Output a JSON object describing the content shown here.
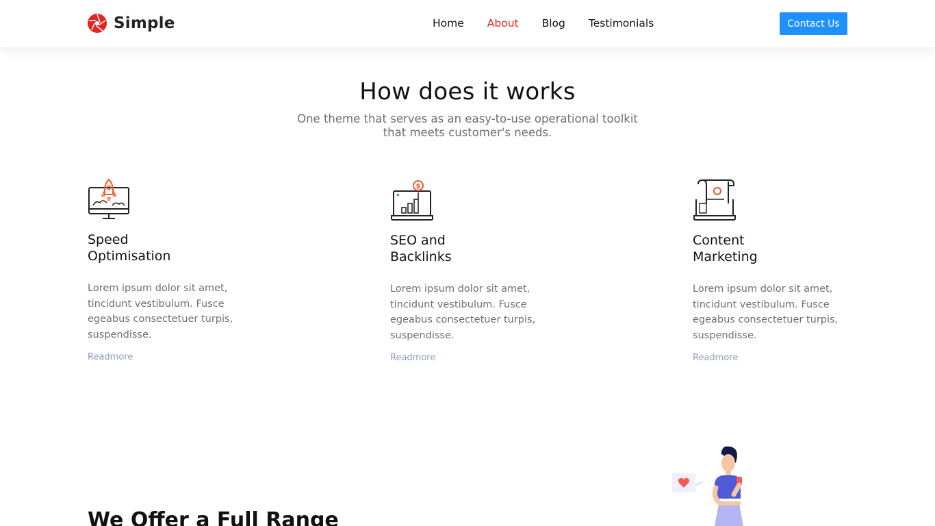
{
  "brand": {
    "name": "Simple",
    "accent": "#e52320"
  },
  "nav": {
    "items": [
      {
        "label": "Home",
        "active": false
      },
      {
        "label": "About",
        "active": true
      },
      {
        "label": "Blog",
        "active": false
      },
      {
        "label": "Testimonials",
        "active": false
      }
    ],
    "cta_label": "Contact Us",
    "cta_color": "#1e90ff"
  },
  "how": {
    "title": "How does it works",
    "subtitle_line1": "One theme that serves as an easy-to-use operational toolkit",
    "subtitle_line2": "that meets customer's needs."
  },
  "features": [
    {
      "icon": "rocket-monitor-icon",
      "title_line1": "Speed",
      "title_line2": "Optimisation",
      "text": "Lorem ipsum dolor sit amet, tincidunt vestibulum. Fusce egeabus consectetuer turpis, suspendisse.",
      "link": "Readmore"
    },
    {
      "icon": "seo-chart-laptop-icon",
      "title_line1": "SEO and",
      "title_line2": "Backlinks",
      "text": "Lorem ipsum dolor sit amet, tincidunt vestibulum. Fusce egeabus consectetuer turpis, suspendisse.",
      "link": "Readmore"
    },
    {
      "icon": "content-scroll-laptop-icon",
      "title_line1": "Content",
      "title_line2": "Marketing",
      "text": "Lorem ipsum dolor sit amet, tincidunt vestibulum. Fusce egeabus consectetuer turpis, suspendisse.",
      "link": "Readmore"
    }
  ],
  "offer": {
    "title": "We Offer a Full Range"
  }
}
